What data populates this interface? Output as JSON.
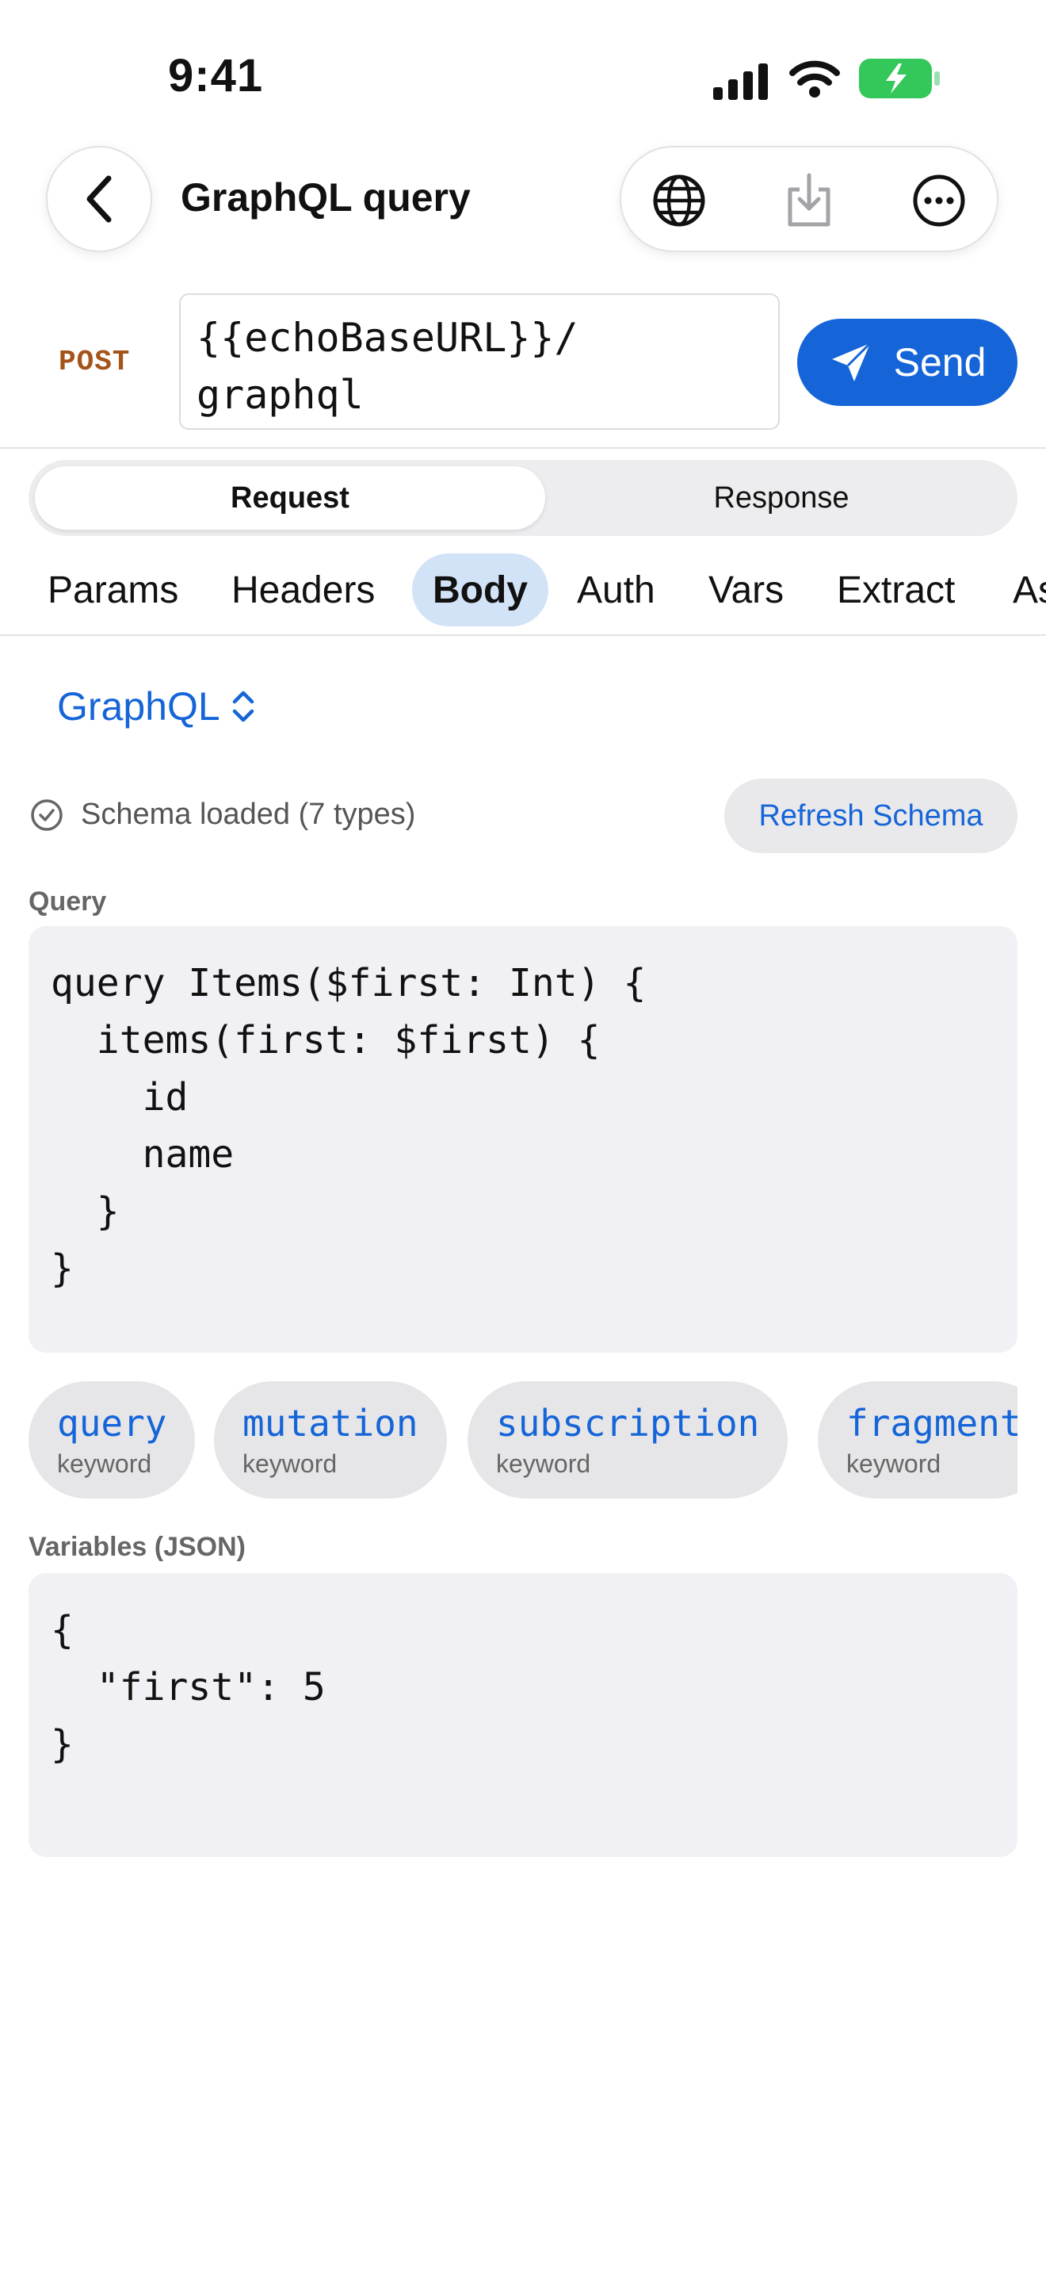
{
  "status_bar": {
    "time": "9:41"
  },
  "nav": {
    "title": "GraphQL query",
    "icons": [
      "back-chevron-icon",
      "globe-icon",
      "download-icon",
      "more-ellipsis-icon"
    ]
  },
  "request": {
    "method": "POST",
    "url_line1": "{{echoBaseURL}}/",
    "url_line2": "graphql",
    "send_label": "Send"
  },
  "segments": {
    "request": "Request",
    "response": "Response"
  },
  "tabs": [
    "Params",
    "Headers",
    "Body",
    "Auth",
    "Vars",
    "Extract",
    "As"
  ],
  "body": {
    "type_label": "GraphQL",
    "schema_status": "Schema loaded (7 types)",
    "refresh_label": "Refresh Schema",
    "query_label": "Query",
    "query_text": "query Items($first: Int) {\n  items(first: $first) {\n    id\n    name\n  }\n}",
    "suggestions": [
      {
        "keyword": "query",
        "kind": "keyword"
      },
      {
        "keyword": "mutation",
        "kind": "keyword"
      },
      {
        "keyword": "subscription",
        "kind": "keyword"
      },
      {
        "keyword": "fragment",
        "kind": "keyword"
      }
    ],
    "variables_label": "Variables (JSON)",
    "variables_text": "{\n  \"first\": 5\n}"
  },
  "colors": {
    "accent": "#1565d8",
    "method_post": "#a4531a",
    "battery_green": "#34c759"
  }
}
